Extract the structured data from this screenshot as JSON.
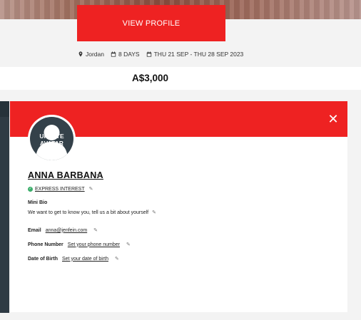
{
  "hero": {
    "view_profile_label": "VIEW PROFILE"
  },
  "trip": {
    "location": "Jordan",
    "duration": "8 DAYS",
    "dates": "THU 21 SEP - THU 28 SEP 2023",
    "price": "A$3,000"
  },
  "profile": {
    "avatar_label": "UPDATE AVATAR",
    "name": "ANNA BARBANA",
    "express_interest": "EXPRESS INTEREST",
    "mini_bio_label": "Mini Bio",
    "mini_bio_text": "We want to get to know you, tell us a bit about yourself",
    "email_label": "Email",
    "email_value": "anna@jenfein.com",
    "phone_label": "Phone Number",
    "phone_value": "Set your phone number",
    "dob_label": "Date of Birth",
    "dob_value": "Set your date of birth",
    "close_glyph": "✕",
    "edit_glyph": "✎"
  },
  "colors": {
    "accent": "#ee2222",
    "dark": "#34414a",
    "check": "#3cae6b"
  }
}
